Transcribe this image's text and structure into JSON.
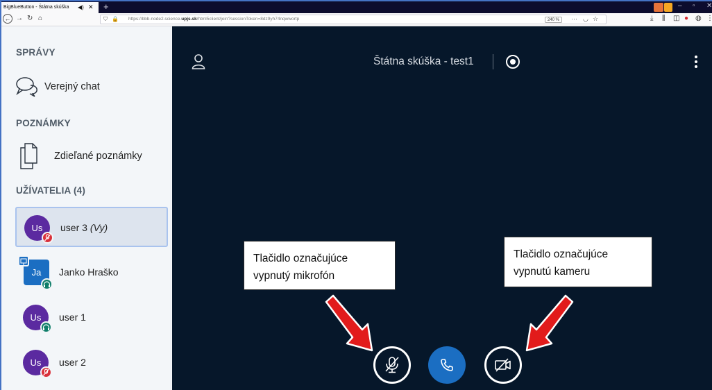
{
  "browser": {
    "tab_title": "BigBlueButton - Štátna skúška",
    "url_prefix": "https://bbb-node2.science.",
    "url_domain": "upjs.sk",
    "url_path": "/html5client/join?sessionToken=8dz9yh74nqwwortp",
    "zoom": "240 %"
  },
  "sidebar": {
    "messages_title": "SPRÁVY",
    "public_chat_label": "Verejný chat",
    "notes_title": "POZNÁMKY",
    "shared_notes_label": "Zdieľané poznámky",
    "users_title": "UŽÍVATELIA (4)",
    "users": [
      {
        "initials": "Us",
        "name": "user 3",
        "suffix": "(Vy)"
      },
      {
        "initials": "Ja",
        "name": "Janko Hraško"
      },
      {
        "initials": "Us",
        "name": "user 1"
      },
      {
        "initials": "Us",
        "name": "user 2"
      }
    ]
  },
  "main": {
    "meeting_title": "Štátna skúška - test1"
  },
  "callouts": {
    "mic_line1": "Tlačidlo označujúce",
    "mic_line2": "vypnutý mikrofón",
    "cam_line1": "Tlačidlo označujúce",
    "cam_line2": "vypnutú kameru"
  },
  "colors": {
    "main_bg": "#06172a",
    "accent_blue": "#1b6ec2",
    "avatar_purple": "#5b2aa0",
    "muted_red": "#d9303a",
    "listen_green": "#0f7e6a",
    "arrow_red": "#e21b1b"
  }
}
